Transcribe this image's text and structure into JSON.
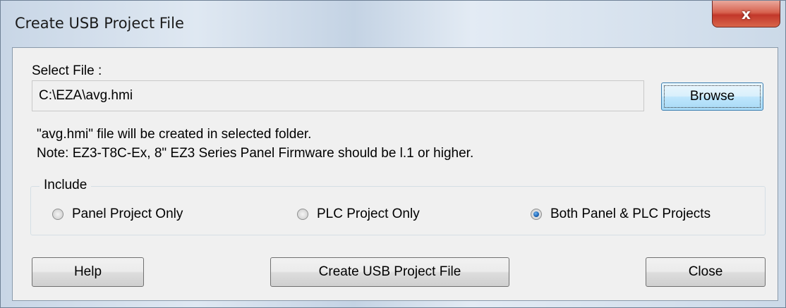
{
  "window": {
    "title": "Create USB Project File",
    "close_glyph": "x"
  },
  "select_file": {
    "label": "Select File :",
    "value": "C:\\EZA\\avg.hmi",
    "browse_label": "Browse"
  },
  "info": {
    "line1": "\"avg.hmi\" file will be created in selected folder.",
    "line2": "Note: EZ3-T8C-Ex, 8\" EZ3 Series Panel Firmware should be l.1 or higher."
  },
  "include": {
    "legend": "Include",
    "options": [
      {
        "label": "Panel Project Only",
        "checked": false
      },
      {
        "label": "PLC Project Only",
        "checked": false
      },
      {
        "label": "Both Panel & PLC Projects",
        "checked": true
      }
    ]
  },
  "buttons": {
    "help": "Help",
    "create": "Create USB Project File",
    "close": "Close"
  }
}
